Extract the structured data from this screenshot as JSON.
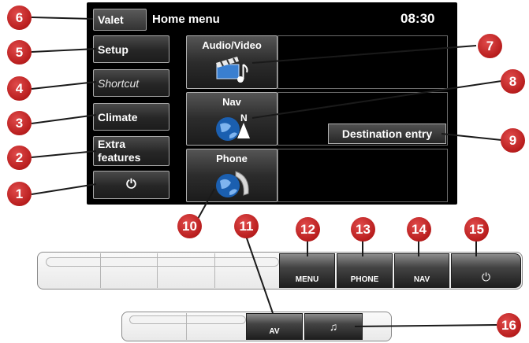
{
  "screen": {
    "title": "Home menu",
    "time": "08:30",
    "valet_label": "Valet",
    "left_buttons": {
      "setup": "Setup",
      "shortcut": "Shortcut",
      "climate": "Climate",
      "extra_line1": "Extra",
      "extra_line2": "features",
      "power_icon": "⏻"
    },
    "tiles": {
      "audio_video": "Audio/Video",
      "nav": "Nav",
      "nav_compass_letter": "N",
      "phone": "Phone"
    },
    "destination_entry": "Destination entry"
  },
  "console": {
    "menu": "MENU",
    "phone": "PHONE",
    "nav": "NAV",
    "power_icon": "⏻",
    "av": "AV",
    "music_icon": "♫"
  },
  "callouts": [
    "1",
    "2",
    "3",
    "4",
    "5",
    "6",
    "7",
    "8",
    "9",
    "10",
    "11",
    "12",
    "13",
    "14",
    "15",
    "16"
  ],
  "colors": {
    "callout": "#c42222",
    "screen_bg": "#000000"
  }
}
